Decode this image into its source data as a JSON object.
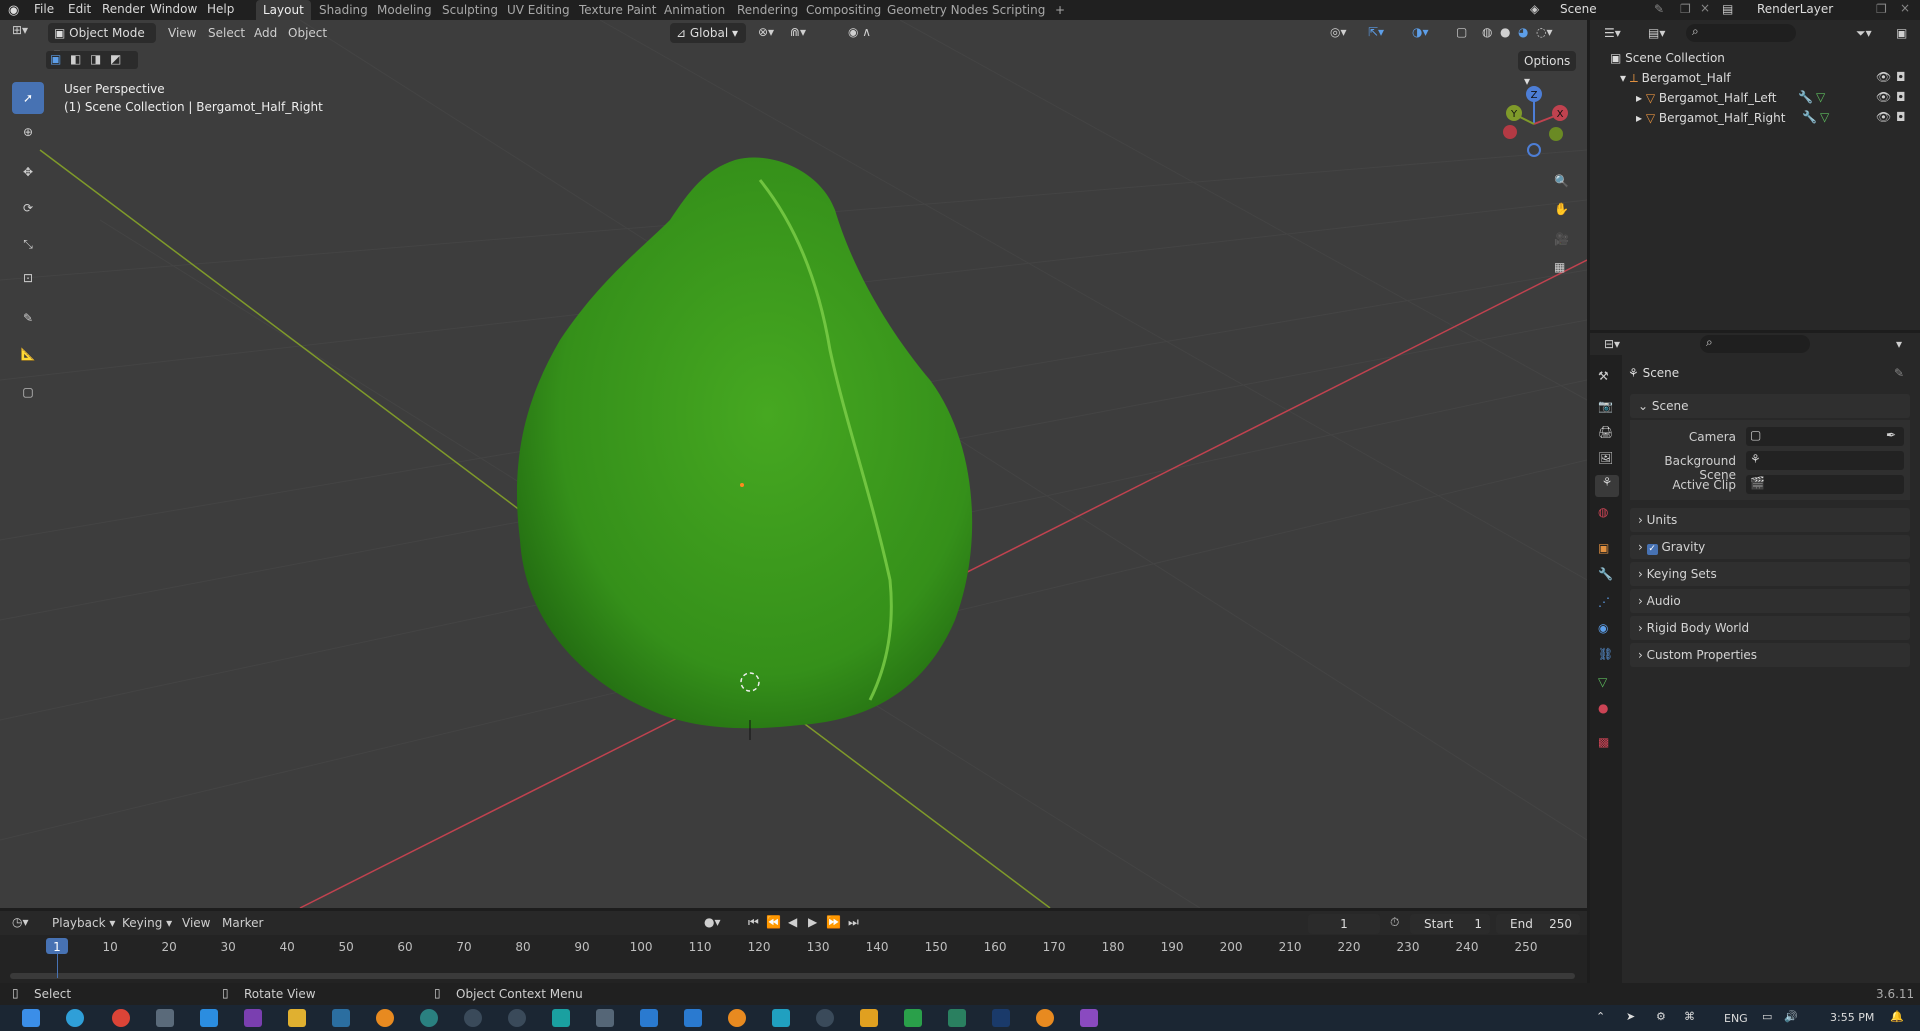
{
  "menu": {
    "items": [
      "File",
      "Edit",
      "Render",
      "Window",
      "Help"
    ]
  },
  "workspaces": {
    "tabs": [
      "Layout",
      "Shading",
      "Modeling",
      "Sculpting",
      "UV Editing",
      "Texture Paint",
      "Animation",
      "Rendering",
      "Compositing",
      "Geometry Nodes",
      "Scripting"
    ],
    "add": "+"
  },
  "top_right": {
    "scene": "Scene",
    "render_layer": "RenderLayer"
  },
  "viewport_header": {
    "mode": "Object Mode",
    "menus": [
      "View",
      "Select",
      "Add",
      "Object"
    ],
    "orientation": "Global",
    "options": "Options"
  },
  "viewport": {
    "perspective": "User Perspective",
    "collection_path": "(1) Scene Collection | Bergamot_Half_Right",
    "gizmo": {
      "x": "X",
      "y": "Y",
      "z": "Z"
    }
  },
  "outliner": {
    "root": "Scene Collection",
    "items": [
      "Bergamot_Half",
      "Bergamot_Half_Left",
      "Bergamot_Half_Right"
    ]
  },
  "properties": {
    "context": "Scene",
    "panel_title": "Scene",
    "fields": [
      {
        "label": "Camera",
        "value": ""
      },
      {
        "label": "Background Scene",
        "value": ""
      },
      {
        "label": "Active Clip",
        "value": ""
      }
    ],
    "sections": [
      "Units",
      "Gravity",
      "Keying Sets",
      "Audio",
      "Rigid Body World",
      "Custom Properties"
    ]
  },
  "timeline": {
    "menus": [
      "Playback",
      "Keying",
      "View",
      "Marker"
    ],
    "current_frame": "1",
    "start_label": "Start",
    "start": "1",
    "end_label": "End",
    "end": "250",
    "ticks": [
      "1",
      "10",
      "20",
      "30",
      "40",
      "50",
      "60",
      "70",
      "80",
      "90",
      "100",
      "110",
      "120",
      "130",
      "140",
      "150",
      "160",
      "170",
      "180",
      "190",
      "200",
      "210",
      "220",
      "230",
      "240",
      "250"
    ]
  },
  "status": {
    "select": "Select",
    "rotate": "Rotate View",
    "context_menu": "Object Context Menu",
    "version": "3.6.11"
  },
  "taskbar": {
    "lang": "ENG",
    "time": "3:55 PM"
  },
  "colors": {
    "accent": "#4772b3",
    "grid_x": "#c0424f",
    "grid_y": "#7f9a2a",
    "object": "#3f9d1e"
  }
}
